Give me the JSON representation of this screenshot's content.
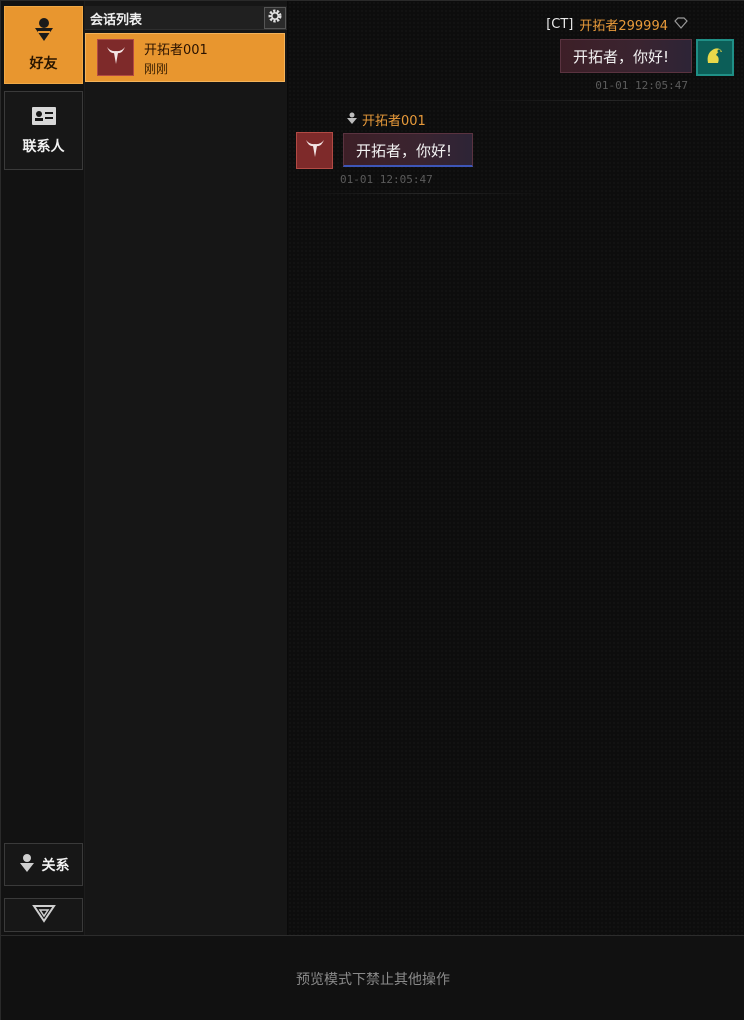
{
  "sidebar": {
    "friends_label": "好友",
    "contacts_label": "联系人",
    "relation_label": "关系"
  },
  "conversations": {
    "title": "会话列表",
    "items": [
      {
        "name": "开拓者001",
        "time": "刚刚"
      }
    ]
  },
  "chat": {
    "me": {
      "tag": "[CT]",
      "name": "开拓者299994",
      "message": "开拓者，你好!",
      "timestamp": "01-01 12:05:47"
    },
    "them": {
      "name": "开拓者001",
      "message": "开拓者，你好!",
      "timestamp": "01-01 12:05:47"
    }
  },
  "footer": {
    "notice": "预览模式下禁止其他操作"
  },
  "colors": {
    "accent": "#e8962f",
    "name_orange": "#e89a3a",
    "avatar_red": "#7e2a2a",
    "avatar_teal": "#0c5e58"
  }
}
